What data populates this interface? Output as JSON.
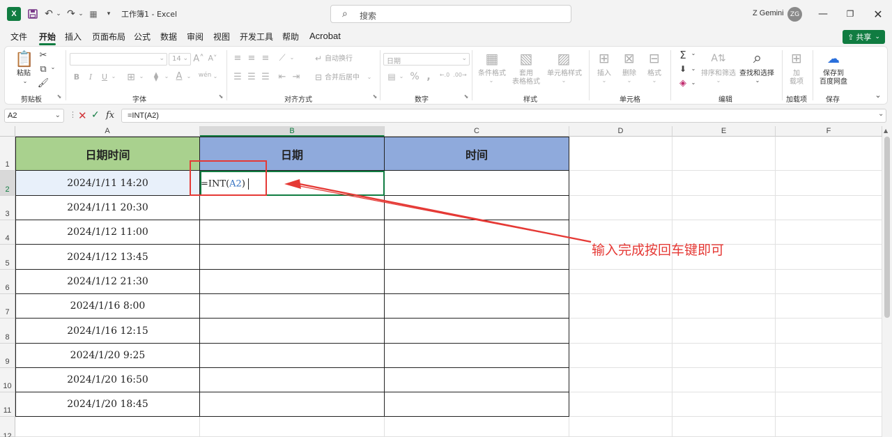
{
  "window": {
    "title": "工作簿1 - Excel",
    "search_placeholder": "搜索",
    "user_name": "Z Gemini",
    "user_initials": "ZG",
    "share_label": "共享"
  },
  "menu": [
    "文件",
    "开始",
    "插入",
    "页面布局",
    "公式",
    "数据",
    "审阅",
    "视图",
    "开发工具",
    "帮助",
    "Acrobat"
  ],
  "ribbon": {
    "clipboard": {
      "paste": "粘贴",
      "group": "剪贴板"
    },
    "font": {
      "size": "14",
      "group": "字体"
    },
    "alignment": {
      "wrap": "自动换行",
      "merge": "合并后居中",
      "group": "对齐方式"
    },
    "number": {
      "format": "日期",
      "group": "数字"
    },
    "styles": {
      "conditional": "条件格式",
      "table_line1": "套用",
      "table_line2": "表格格式",
      "cell_styles": "单元格样式",
      "group": "样式"
    },
    "cells": {
      "insert": "插入",
      "delete": "删除",
      "format": "格式",
      "group": "单元格"
    },
    "editing": {
      "sort": "排序和筛选",
      "find": "查找和选择",
      "group": "编辑"
    },
    "addins": {
      "line1": "加",
      "line2": "载项",
      "group": "加载项"
    },
    "save": {
      "line1": "保存到",
      "line2": "百度网盘",
      "group": "保存"
    }
  },
  "formula_bar": {
    "name_box": "A2",
    "formula": "=INT(A2)"
  },
  "columns": [
    "A",
    "B",
    "C",
    "D",
    "E",
    "F"
  ],
  "rows": [
    "1",
    "2",
    "3",
    "4",
    "5",
    "6",
    "7",
    "8",
    "9",
    "10",
    "11",
    "12"
  ],
  "table": {
    "headers": [
      "日期时间",
      "日期",
      "时间"
    ],
    "datetimes": [
      "2024/1/11  14:20",
      "2024/1/11  20:30",
      "2024/1/12  11:00",
      "2024/1/12  13:45",
      "2024/1/12  21:30",
      "2024/1/16  8:00",
      "2024/1/16  12:15",
      "2024/1/20  9:25",
      "2024/1/20  16:50",
      "2024/1/20  18:45"
    ]
  },
  "edit": {
    "prefix": "=INT(",
    "ref": "A2",
    "suffix": ")"
  },
  "annotation": "输入完成按回车键即可",
  "colors": {
    "excel_green": "#107c41",
    "header_a": "#a9d18e",
    "header_bc": "#8faadc",
    "annotation_red": "#e53935"
  }
}
